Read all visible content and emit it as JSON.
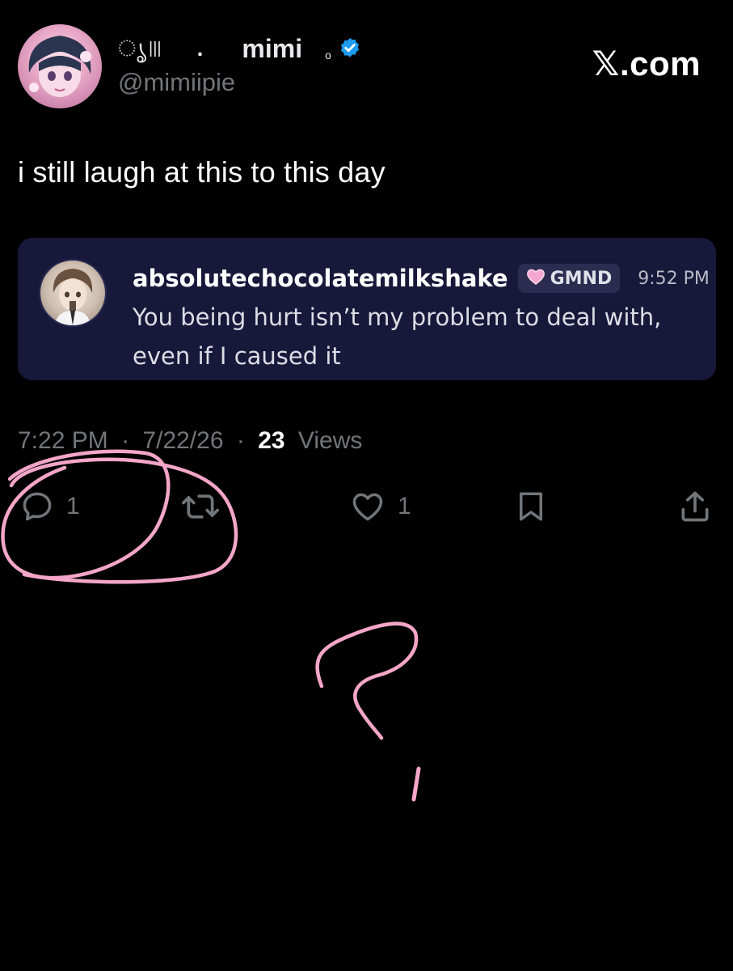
{
  "header": {
    "display_name_prefix": "ൃ",
    "display_name_dot": ".",
    "display_name": "mimi",
    "display_name_suffix": "ο",
    "handle": "@mimiipie",
    "site_label": "𝕏.com"
  },
  "tweet": {
    "text": "i still laugh at this to this day",
    "time": "7:22 PM",
    "date": "7/22/26",
    "separator": "·",
    "views_count": "23",
    "views_label": "Views"
  },
  "quote": {
    "username": "absolutechocolatemilkshake",
    "tag": "GMND",
    "time": "9:52 PM",
    "text": "You being hurt isn’t my problem to deal with, even if I caused it"
  },
  "actions": {
    "reply_count": "1",
    "like_count": "1"
  },
  "colors": {
    "background": "#000000",
    "card": "#17183a",
    "verified": "#1d9bf0",
    "muted": "#71767b",
    "annotation": "#f4a6c8"
  },
  "icons": [
    "verified-badge-icon",
    "heart-tag-icon",
    "reply-icon",
    "retweet-icon",
    "like-icon",
    "bookmark-icon",
    "share-icon"
  ]
}
